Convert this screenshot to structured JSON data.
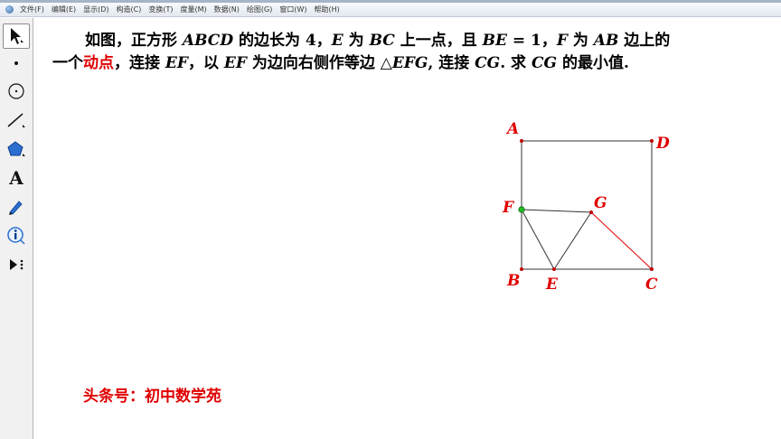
{
  "menu": {
    "items": [
      "文件(F)",
      "编辑(E)",
      "显示(D)",
      "构造(C)",
      "变换(T)",
      "度量(M)",
      "数据(N)",
      "绘图(G)",
      "窗口(W)",
      "帮助(H)"
    ]
  },
  "toolbox": {
    "tools": [
      "select-arrow-tool",
      "point-tool",
      "compass-tool",
      "straightedge-tool",
      "polygon-tool",
      "text-tool",
      "marker-tool",
      "information-tool",
      "custom-tool"
    ],
    "text_tool_glyph": "A"
  },
  "problem": {
    "l1_a": "如图，正方形 ",
    "l1_abcd": "ABCD",
    "l1_b": " 的边长为 4，",
    "l1_e": "E",
    "l1_c": " 为 ",
    "l1_bc": "BC",
    "l1_d": " 上一点，且 ",
    "l1_be": "BE",
    "l1_eq": " = 1，",
    "l1_f": "F",
    "l1_g": " 为 ",
    "l1_ab": "AB",
    "l1_h": " 边上的",
    "l2_a": "一个",
    "l2_highlight": "动点",
    "l2_b": "，连接 ",
    "l2_ef": "EF",
    "l2_c": "，以 ",
    "l2_ef2": "EF",
    "l2_d": " 为边向右侧作等边 △",
    "l2_efg": "EFG",
    "l2_e": ", 连接 ",
    "l2_cg": "CG",
    "l2_f": ". 求 ",
    "l2_cg2": "CG",
    "l2_g": " 的最小值."
  },
  "figure": {
    "labels": {
      "A": "A",
      "B": "B",
      "C": "C",
      "D": "D",
      "E": "E",
      "F": "F",
      "G": "G"
    },
    "line_color": "#333333",
    "highlight_color": "#e00000",
    "point_color": "#c00000",
    "active_point_color": "#22bb22"
  },
  "watermark": "头条号：初中数学苑"
}
